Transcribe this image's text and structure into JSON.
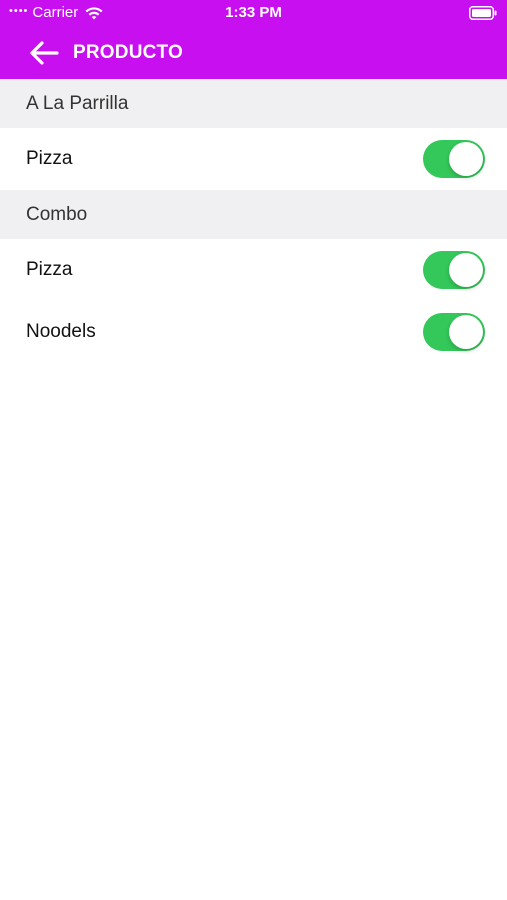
{
  "status_bar": {
    "carrier": "Carrier",
    "time": "1:33 PM",
    "wifi_icon": "wifi-icon",
    "battery_icon": "battery-icon"
  },
  "nav": {
    "back_icon": "arrow-left-icon",
    "title": "PRODUCTO",
    "background_color": "#c80ff0"
  },
  "sections": [
    {
      "title": "A La Parrilla",
      "items": [
        {
          "label": "Pizza",
          "enabled": true
        }
      ]
    },
    {
      "title": "Combo",
      "items": [
        {
          "label": "Pizza",
          "enabled": true
        },
        {
          "label": "Noodels",
          "enabled": true
        }
      ]
    }
  ],
  "colors": {
    "toggle_on": "#34c759",
    "section_bg": "#f0f0f2"
  }
}
